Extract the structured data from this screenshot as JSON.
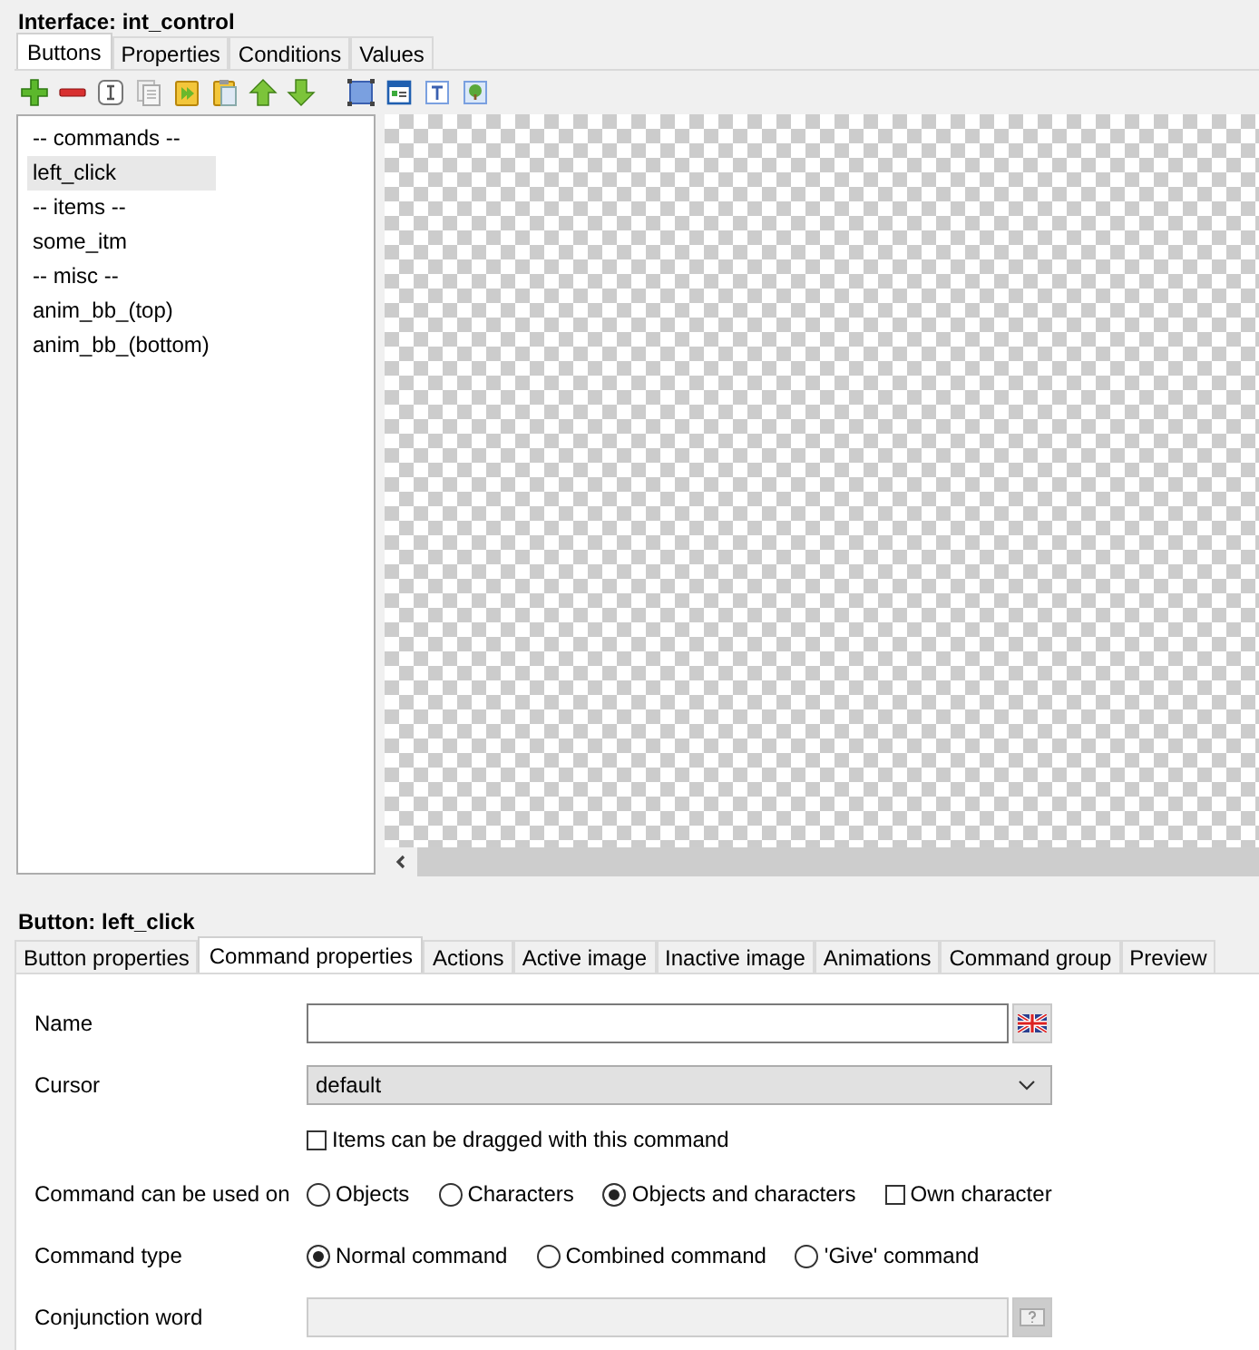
{
  "window": {
    "title": "Interface: int_control"
  },
  "tabs": [
    {
      "label": "Buttons",
      "selected": true
    },
    {
      "label": "Properties",
      "selected": false
    },
    {
      "label": "Conditions",
      "selected": false
    },
    {
      "label": "Values",
      "selected": false
    }
  ],
  "list": {
    "items": [
      {
        "label": "-- commands --",
        "selected": false
      },
      {
        "label": "left_click",
        "selected": true
      },
      {
        "label": "-- items --",
        "selected": false
      },
      {
        "label": "some_itm",
        "selected": false
      },
      {
        "label": "-- misc --",
        "selected": false
      },
      {
        "label": "anim_bb_(top)",
        "selected": false
      },
      {
        "label": "anim_bb_(bottom)",
        "selected": false
      }
    ]
  },
  "detail": {
    "title": "Button: left_click",
    "tabs": [
      {
        "label": "Button properties",
        "selected": false
      },
      {
        "label": "Command properties",
        "selected": true
      },
      {
        "label": "Actions",
        "selected": false
      },
      {
        "label": "Active image",
        "selected": false
      },
      {
        "label": "Inactive image",
        "selected": false
      },
      {
        "label": "Animations",
        "selected": false
      },
      {
        "label": "Command group",
        "selected": false
      },
      {
        "label": "Preview",
        "selected": false
      }
    ],
    "name": {
      "label": "Name"
    },
    "cursor": {
      "label": "Cursor",
      "value": "default"
    },
    "drag_checkbox": {
      "label": "Items can be dragged with this command",
      "checked": false
    },
    "used_on": {
      "label": "Command can be used on",
      "options": [
        {
          "kind": "radio",
          "label": "Objects",
          "selected": false
        },
        {
          "kind": "radio",
          "label": "Characters",
          "selected": false
        },
        {
          "kind": "radio",
          "label": "Objects and characters",
          "selected": true
        },
        {
          "kind": "checkbox",
          "label": "Own character",
          "selected": false
        }
      ]
    },
    "command_type": {
      "label": "Command type",
      "options": [
        {
          "label": "Normal command",
          "selected": true
        },
        {
          "label": "Combined command",
          "selected": false
        },
        {
          "label": "'Give' command",
          "selected": false
        }
      ]
    },
    "conjunction": {
      "label": "Conjunction word",
      "disabled": true
    }
  }
}
